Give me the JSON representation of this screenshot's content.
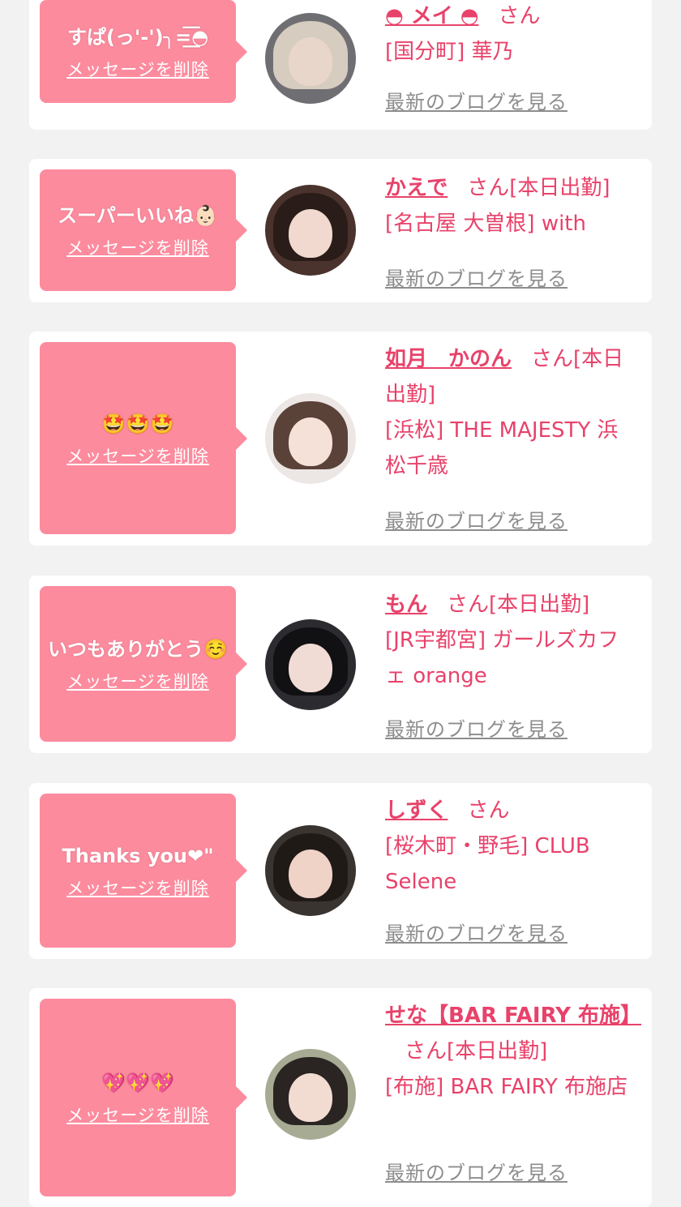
{
  "delete_label": "メッセージを削除",
  "blog_label": "最新のブログを見る",
  "honorific": "さん",
  "colors": {
    "bubble": "#fd8b9e",
    "accent": "#e8426a",
    "muted": "#8d8d8d"
  },
  "items": [
    {
      "message": "すぱ(っ'-')╮=͟͟͞͞◓",
      "name": "◓ メイ ◓",
      "status": "",
      "shop": "[国分町] 華乃"
    },
    {
      "message": "スーパーいいね👶🏻",
      "name": "かえで",
      "status": "[本日出勤]",
      "shop": "[名古屋 大曽根] with"
    },
    {
      "message": "🤩🤩🤩",
      "name": "如月　かのん",
      "status": "[本日出勤]",
      "shop": "[浜松] THE MAJESTY 浜松千歳"
    },
    {
      "message": "いつもありがとう☺️",
      "name": "もん",
      "status": "[本日出勤]",
      "shop": "[JR宇都宮] ガールズカフェ orange"
    },
    {
      "message": "Thanks you❤︎\"",
      "name": "しずく",
      "status": "",
      "shop": "[桜木町・野毛] CLUB Selene"
    },
    {
      "message": "💖💖💖",
      "name": "せな【BAR FAIRY 布施】",
      "status": "[本日出勤]",
      "shop": "[布施] BAR FAIRY 布施店"
    }
  ]
}
